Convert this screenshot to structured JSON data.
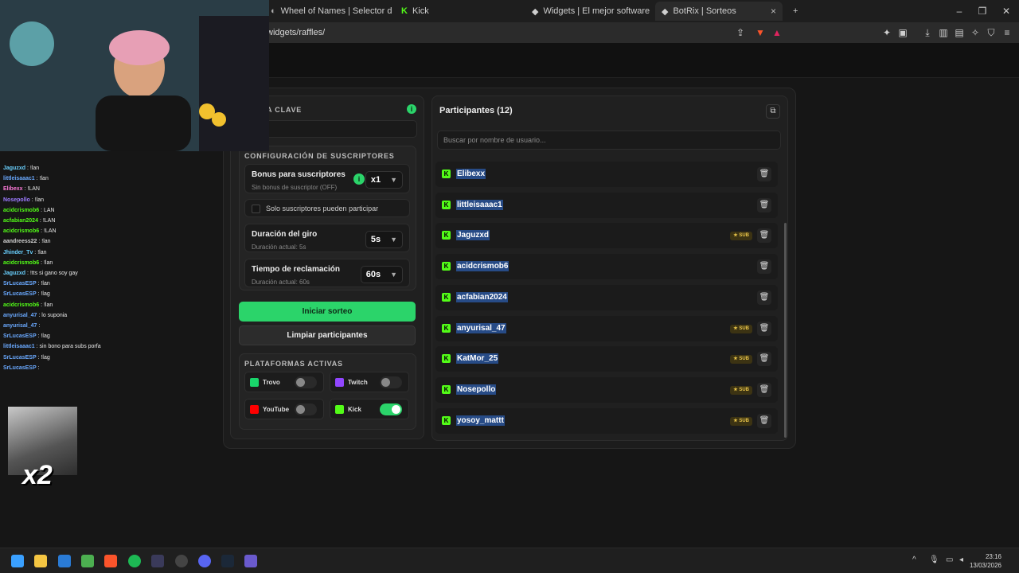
{
  "browser": {
    "tabs": [
      {
        "label": "Wheel of Names | Selector de nombr",
        "icon": "wheel-icon"
      },
      {
        "label": "Kick",
        "icon": "kick-icon"
      },
      {
        "label": "Widgets | El mejor software para pot",
        "icon": "widgets-icon"
      },
      {
        "label": "BotRix | Sorteos",
        "icon": "botrix-icon",
        "active": true
      }
    ],
    "url": "widgets/raffles/"
  },
  "left_panel": {
    "keyword_label": "A CLAVE",
    "subscriber_config_title": "CONFIGURACIÓN DE SUSCRIPTORES",
    "bonus": {
      "title": "Bonus para suscriptores",
      "desc": "Sin bonus de suscriptor (OFF)",
      "value": "x1"
    },
    "only_subs_label": "Solo suscriptores pueden participar",
    "spin_duration": {
      "title": "Duración del giro",
      "desc": "Duración actual: 5s",
      "value": "5s"
    },
    "claim_time": {
      "title": "Tiempo de reclamación",
      "desc": "Duración actual: 60s",
      "value": "60s"
    },
    "start_button": "Iniciar sorteo",
    "clear_button": "Limpiar participantes",
    "platforms_title": "PLATAFORMAS ACTIVAS",
    "platforms": [
      {
        "name": "Trovo",
        "enabled": false,
        "color": "#19d66b"
      },
      {
        "name": "Twitch",
        "enabled": false,
        "color": "#9146ff"
      },
      {
        "name": "YouTube",
        "enabled": false,
        "color": "#ff0000"
      },
      {
        "name": "Kick",
        "enabled": true,
        "color": "#53fc18"
      }
    ]
  },
  "participants": {
    "title": "Participantes (12)",
    "search_placeholder": "Buscar por nombre de usuario...",
    "sub_badge": "★ SUB",
    "rows": [
      {
        "name": "Elibexx",
        "sub": false
      },
      {
        "name": "littleisaaac1",
        "sub": false
      },
      {
        "name": "Jaguzxd",
        "sub": true
      },
      {
        "name": "acidcrismob6",
        "sub": false
      },
      {
        "name": "acfabian2024",
        "sub": false
      },
      {
        "name": "anyurisal_47",
        "sub": true
      },
      {
        "name": "KatMor_25",
        "sub": true
      },
      {
        "name": "Nosepollo",
        "sub": true
      },
      {
        "name": "yosoy_mattt",
        "sub": true
      }
    ]
  },
  "chat": [
    {
      "user": "Jaguzxd",
      "msg": "!lan",
      "color": "#6ad1ff"
    },
    {
      "user": "littleisaaac1",
      "msg": "!lan",
      "color": "#6aa9ff"
    },
    {
      "user": "Elibexx",
      "msg": "!LAN",
      "color": "#ff7ad9"
    },
    {
      "user": "Nosepollo",
      "msg": "!lan",
      "color": "#9d7bff"
    },
    {
      "user": "acidcrismob6",
      "msg": "LAN",
      "color": "#53fc18"
    },
    {
      "user": "acfabian2024",
      "msg": "!LAN",
      "color": "#53fc18"
    },
    {
      "user": "acidcrismob6",
      "msg": "!LAN",
      "color": "#53fc18"
    },
    {
      "user": "aandreess22",
      "msg": "!lan",
      "color": "#cfcfcf"
    },
    {
      "user": "Jhinder_Tv",
      "msg": "!lan",
      "color": "#6ad1ff"
    },
    {
      "user": "acidcrismob6",
      "msg": "!lan",
      "color": "#53fc18"
    },
    {
      "user": "Jaguzxd",
      "msg": "!tts si gano soy gay",
      "color": "#6ad1ff"
    },
    {
      "user": "SrLucasESP",
      "msg": "!lan",
      "color": "#6aa9ff"
    },
    {
      "user": "SrLucasESP",
      "msg": "!lag",
      "color": "#6aa9ff"
    },
    {
      "user": "acidcrismob6",
      "msg": "!lan",
      "color": "#53fc18"
    },
    {
      "user": "anyurisal_47",
      "msg": "lo suponia",
      "color": "#6aa9ff"
    },
    {
      "user": "anyurisal_47",
      "msg": "",
      "color": "#6aa9ff"
    },
    {
      "user": "SrLucasESP",
      "msg": "!lag",
      "color": "#6aa9ff"
    },
    {
      "user": "littleisaaac1",
      "msg": "sin bono para subs porfa",
      "color": "#6aa9ff"
    },
    {
      "user": "SrLucasESP",
      "msg": "!lag",
      "color": "#6aa9ff"
    },
    {
      "user": "SrLucasESP",
      "msg": "",
      "color": "#6aa9ff"
    }
  ],
  "overlay": {
    "gif_label": "x2"
  },
  "clock": {
    "time": "23:16",
    "date": "13/03/2026"
  }
}
